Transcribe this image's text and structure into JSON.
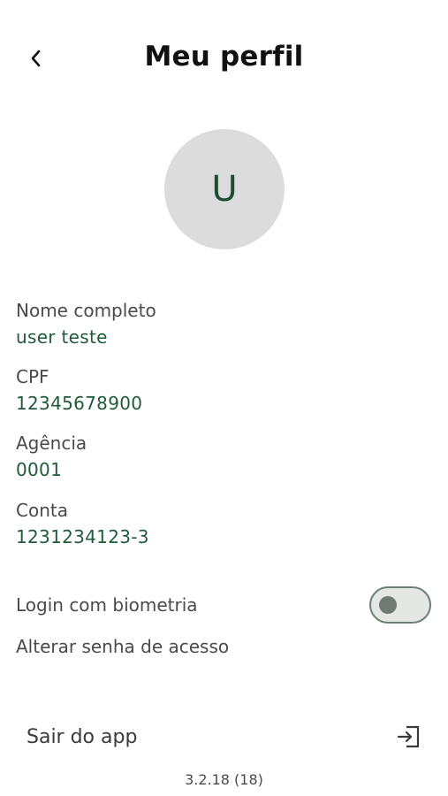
{
  "header": {
    "title": "Meu perfil",
    "back_icon": "chevron-left-icon"
  },
  "avatar": {
    "initial": "U"
  },
  "profile": {
    "fields": [
      {
        "label": "Nome completo",
        "value": "user teste"
      },
      {
        "label": "CPF",
        "value": "12345678900"
      },
      {
        "label": "Agência",
        "value": "0001"
      },
      {
        "label": "Conta",
        "value": "1231234123-3"
      }
    ]
  },
  "settings": {
    "biometric_label": "Login com biometria",
    "biometric_enabled": false,
    "change_password_label": "Alterar senha de acesso"
  },
  "logout": {
    "label": "Sair do app",
    "icon": "logout-icon"
  },
  "footer": {
    "version": "3.2.18 (18)"
  },
  "colors": {
    "accent": "#1f5a3a",
    "avatar_bg": "#dcdcdc",
    "toggle_track": "#e3e8e4"
  }
}
